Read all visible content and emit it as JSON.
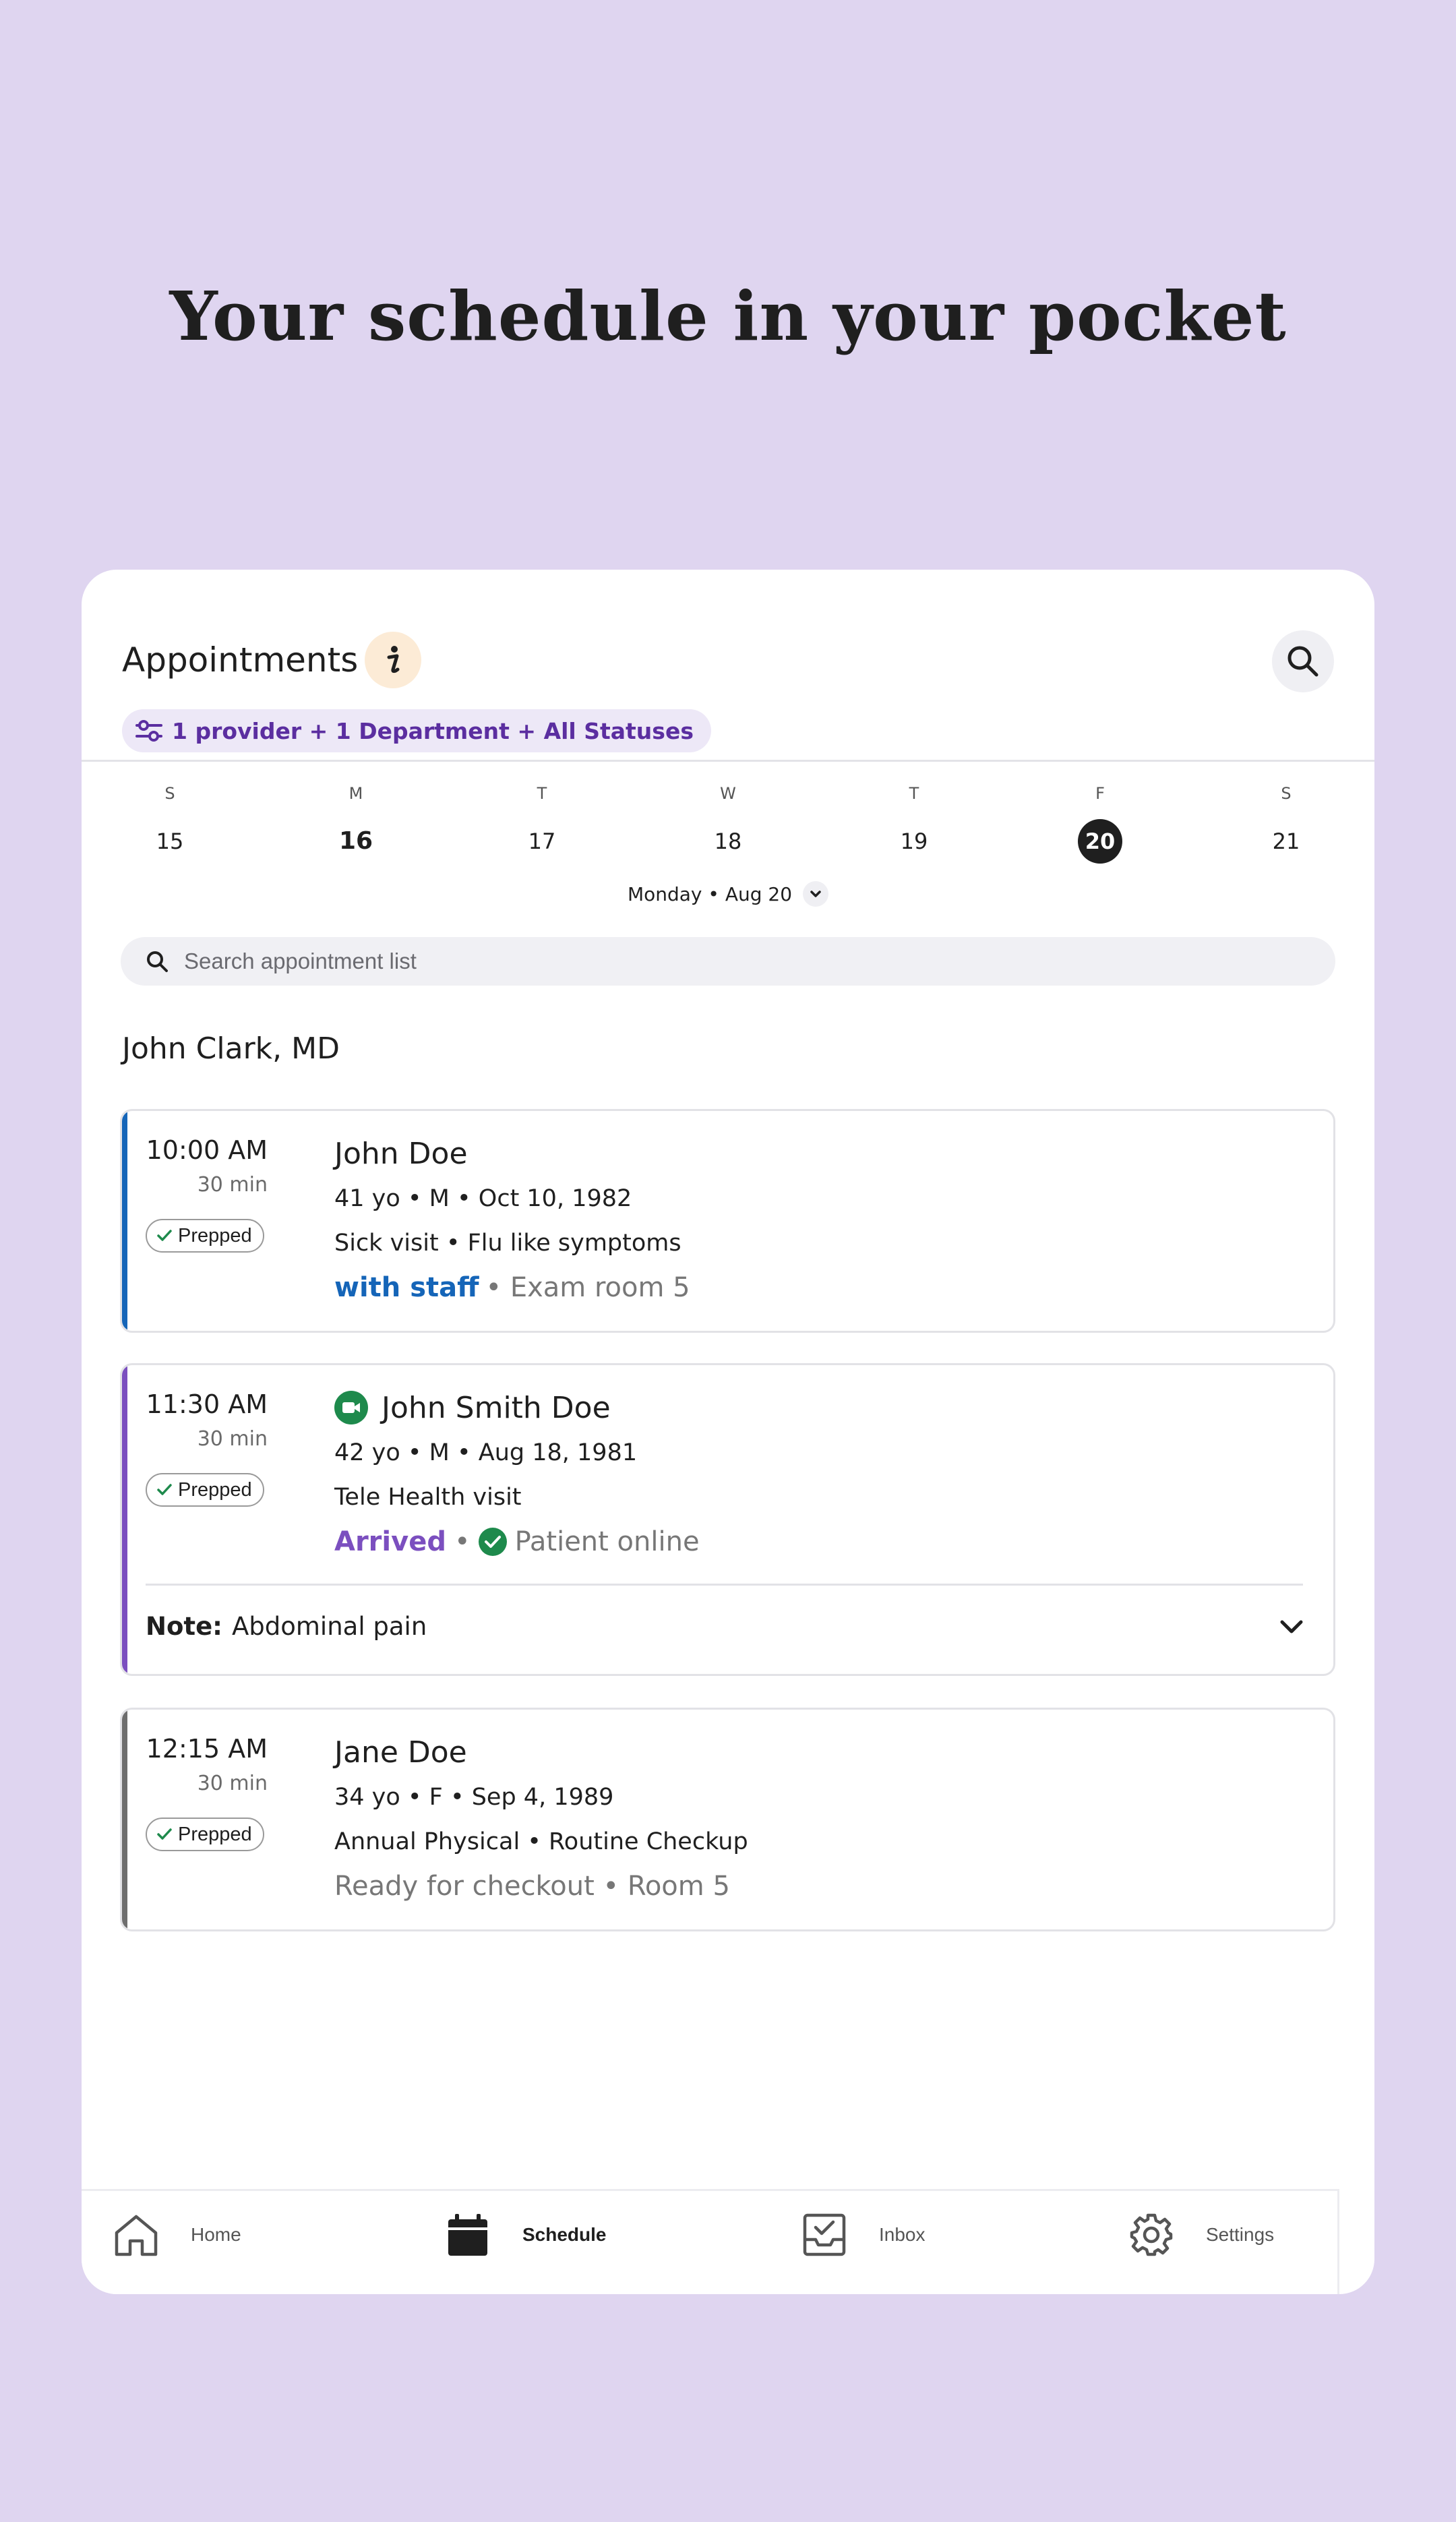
{
  "headline": "Your schedule in your pocket",
  "header": {
    "title": "Appointments",
    "filter_label": "1 provider + 1 Department + All Statuses"
  },
  "week": {
    "days": [
      {
        "letter": "S",
        "num": "15"
      },
      {
        "letter": "M",
        "num": "16"
      },
      {
        "letter": "T",
        "num": "17"
      },
      {
        "letter": "W",
        "num": "18"
      },
      {
        "letter": "T",
        "num": "19"
      },
      {
        "letter": "F",
        "num": "20"
      },
      {
        "letter": "S",
        "num": "21"
      }
    ],
    "selected_label": "Monday • Aug 20"
  },
  "search": {
    "placeholder": "Search appointment list"
  },
  "provider": "John Clark, MD",
  "appointments": [
    {
      "time": "10:00 AM",
      "duration": "30 min",
      "badge": "Prepped",
      "name": "John Doe",
      "demographics": "41 yo • M • Oct 10, 1982",
      "visit": "Sick visit • Flu like symptoms",
      "status_primary": "with staff",
      "status_secondary": "• Exam room 5",
      "accent": "#1565B8"
    },
    {
      "time": "11:30 AM",
      "duration": "30 min",
      "badge": "Prepped",
      "name": "John Smith Doe",
      "demographics": "42 yo • M • Aug 18, 1981",
      "visit": "Tele Health visit",
      "status_primary": "Arrived",
      "status_sep": "•",
      "status_secondary": "Patient online",
      "note_label": "Note:",
      "note_text": "Abdominal pain",
      "accent": "#7B4FBF"
    },
    {
      "time": "12:15 AM",
      "duration": "30 min",
      "badge": "Prepped",
      "name": "Jane Doe",
      "demographics": "34 yo • F • Sep 4, 1989",
      "visit": "Annual Physical • Routine Checkup",
      "status_secondary": "Ready for checkout • Room 5",
      "accent": "#6e6e6e"
    }
  ],
  "tabs": [
    {
      "label": "Home",
      "icon": "home-icon"
    },
    {
      "label": "Schedule",
      "icon": "calendar-icon"
    },
    {
      "label": "Inbox",
      "icon": "inbox-icon"
    },
    {
      "label": "Settings",
      "icon": "gear-icon"
    }
  ],
  "colors": {
    "background": "#DFD5F0",
    "filter_text": "#5B2EA0",
    "video_green": "#1E8A4C"
  }
}
